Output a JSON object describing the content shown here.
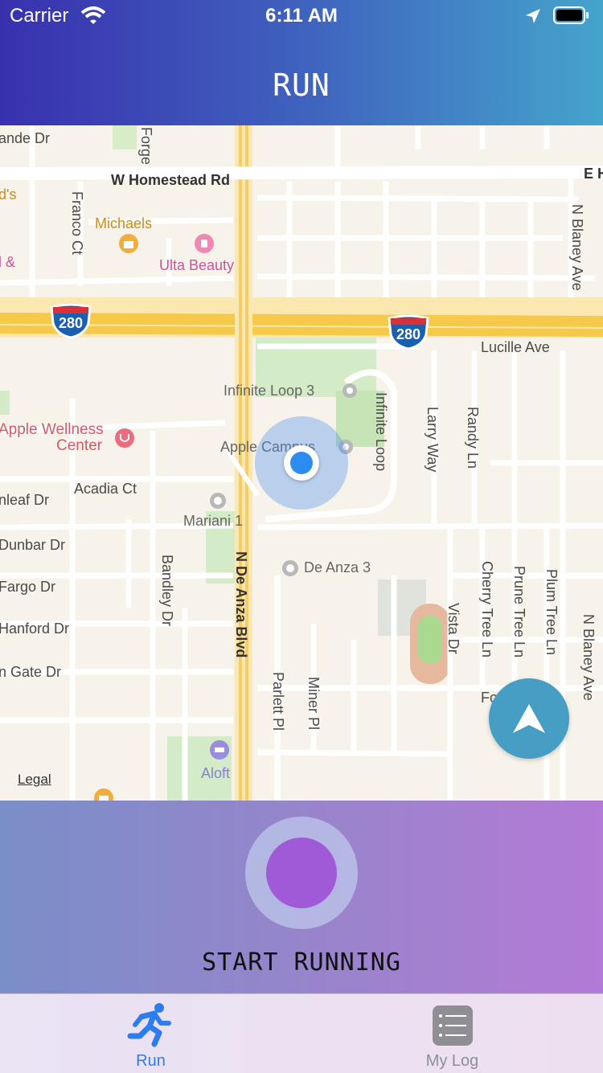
{
  "status_bar": {
    "carrier": "Carrier",
    "time": "6:11 AM"
  },
  "header": {
    "title": "RUN"
  },
  "map": {
    "legal": "Legal",
    "streets": {
      "homestead": "W Homestead Rd",
      "de_anza": "N De Anza Blvd",
      "lucille": "Lucille Ave",
      "bandley": "Bandley Dr",
      "acadia": "Acadia Ct",
      "mariani": "Mariani 1",
      "de_anza_3": "De Anza 3",
      "infinite_loop": "Infinite Loop",
      "infinite_loop_3": "Infinite Loop 3",
      "larry": "Larry Way",
      "randy": "Randy Ln",
      "blaney_n": "N Blaney Ave",
      "blaney_s": "N Blaney Ave",
      "cherry": "Cherry Tree Ln",
      "prune": "Prune Tree Ln",
      "plum": "Plum Tree Ln",
      "vista": "Vista Dr",
      "parlett": "Parlett Pl",
      "miner": "Miner Pl",
      "franco": "Franco Ct",
      "forge": "Forge",
      "dunbar": "Dunbar Dr",
      "fargo": "Fargo Dr",
      "hanford": "Hanford Dr",
      "gate": "n Gate Dr",
      "leaf": "nleaf Dr",
      "ande": "ande Dr",
      "e_h": "E H"
    },
    "pois": {
      "michaels": "Michaels",
      "ulta": "Ulta Beauty",
      "apple_wellness_1": "Apple Wellness",
      "apple_wellness_2": "Center",
      "apple_campus": "Apple Campus",
      "aloft": "Aloft",
      "ds": "d's",
      "l_amp": "l &",
      "fo": "Fo"
    },
    "shields": [
      "280",
      "280"
    ],
    "colors": {
      "highway": "#f6c94a",
      "user_dot": "#2d8cf0",
      "recenter": "#479ec4"
    }
  },
  "run_panel": {
    "start_label": "START RUNNING",
    "button_color": "#a05ad8"
  },
  "tabbar": {
    "tabs": [
      {
        "label": "Run",
        "icon": "runner-icon",
        "active": true,
        "color": "#2d7cf0"
      },
      {
        "label": "My Log",
        "icon": "list-icon",
        "active": false,
        "color": "#8e8e93"
      }
    ]
  }
}
